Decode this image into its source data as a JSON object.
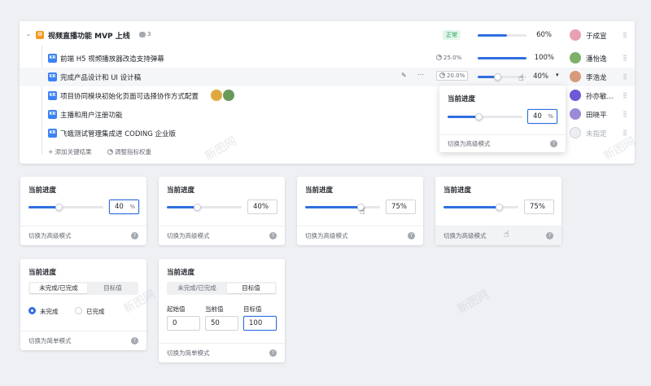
{
  "objective": {
    "title": "视频直播功能 MVP 上线",
    "comment_count": "3",
    "status": "正常",
    "progress": "60%",
    "progress_value": 0.6,
    "owner": "于成宣",
    "badge": "O"
  },
  "key_results": [
    {
      "badge": "KR",
      "title": "前端 H5 视频播放器改造支持弹幕",
      "weight": "25.0%",
      "progress": "100%",
      "progress_value": 1.0,
      "owner": "潘怡逸"
    },
    {
      "badge": "KR",
      "title": "完成产品设计和 UI 设计稿",
      "weight": "20.0%",
      "progress": "40%",
      "progress_value": 0.4,
      "owner": "李浩龙"
    },
    {
      "badge": "KR",
      "title": "项目协同模块初始化页面可选择协作方式配置",
      "owner": "孙亦敏..."
    },
    {
      "badge": "KR",
      "title": "主播和用户注册功能",
      "owner": "田晓平"
    },
    {
      "badge": "KR",
      "title": "飞蛾测试管理集成进 CODING 企业版",
      "owner": "未指定"
    }
  ],
  "actions": {
    "add_kr": "添加关键结果",
    "adjust_weight": "调整指标权重"
  },
  "popover": {
    "title": "当前进度",
    "value": "40",
    "unit": "%",
    "switch": "切换为高级模式",
    "help": "?"
  },
  "cards": [
    {
      "title": "当前进度",
      "value": "40",
      "unit": "%",
      "switch": "切换为高级模式",
      "progress": 0.4
    },
    {
      "title": "当前进度",
      "value": "40%",
      "switch": "切换为高级模式",
      "progress": 0.4
    },
    {
      "title": "当前进度",
      "value": "75%",
      "switch": "切换为高级模式",
      "progress": 0.75
    },
    {
      "title": "当前进度",
      "value": "75%",
      "switch": "切换为高级模式",
      "progress": 0.75
    }
  ],
  "card5": {
    "title": "当前进度",
    "tab1": "未完成/已完成",
    "tab2": "目标值",
    "opt1": "未完成",
    "opt2": "已完成",
    "switch": "切换为简单模式"
  },
  "card6": {
    "title": "当前进度",
    "tab1": "未完成/已完成",
    "tab2": "目标值",
    "start_label": "起始值",
    "current_label": "当前值",
    "target_label": "目标值",
    "start": "0",
    "current": "50",
    "target": "100",
    "switch": "切换为简单模式"
  },
  "watermark": "新图网",
  "colors": {
    "accent": "#2f6fe0",
    "status_green": "#1f9d55",
    "objective_orange": "#f59a23"
  }
}
